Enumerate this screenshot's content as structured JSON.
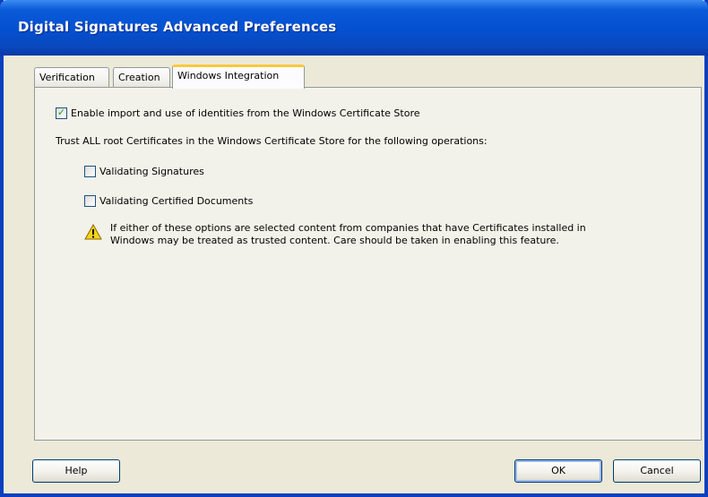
{
  "window": {
    "title": "Digital Signatures Advanced Preferences"
  },
  "tabs": [
    {
      "label": "Verification",
      "active": false
    },
    {
      "label": "Creation",
      "active": false
    },
    {
      "label": "Windows Integration",
      "active": true
    }
  ],
  "options": {
    "enable_import": {
      "label": "Enable import and use of identities from the Windows Certificate Store",
      "checked": true
    },
    "trust_heading": "Trust ALL root Certificates in the Windows Certificate Store for the following operations:",
    "validating_signatures": {
      "label": "Validating Signatures",
      "checked": false
    },
    "validating_certified": {
      "label": "Validating Certified Documents",
      "checked": false
    }
  },
  "warning": {
    "icon": "warning-triangle-icon",
    "line1": "If either of these options are selected content from companies that have Certificates installed in",
    "line2": "Windows may be treated as trusted content. Care should be taken in enabling this feature."
  },
  "buttons": {
    "help": "Help",
    "ok": "OK",
    "cancel": "Cancel"
  },
  "colors": {
    "titlebar": "#0450d0",
    "window_bg": "#ece9d8",
    "active_tab_highlight": "#ffc83c",
    "checkmark": "#21a121"
  }
}
